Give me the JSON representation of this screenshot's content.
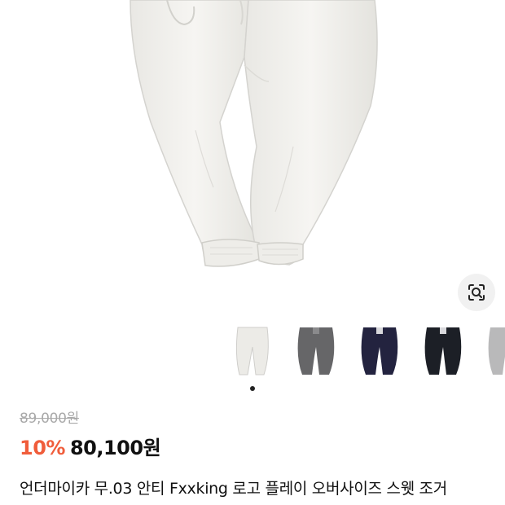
{
  "product": {
    "original_price": "89,000원",
    "discount_rate": "10%",
    "sale_price": "80,100원",
    "title": "언더마이카 무.03 안티 Fxxking 로고 플레이 오버사이즈 스웻 조거"
  },
  "gallery": {
    "current_index": 1,
    "total_dots": 1,
    "thumbnails": [
      {
        "name": "thumbnail-white",
        "color": "#ecebe7"
      },
      {
        "name": "thumbnail-gray",
        "color": "#666668"
      },
      {
        "name": "thumbnail-navy",
        "color": "#23233f"
      },
      {
        "name": "thumbnail-black",
        "color": "#1c1f26"
      },
      {
        "name": "thumbnail-light-gray",
        "color": "#b9b9ba"
      }
    ]
  },
  "icons": {
    "lens": "lens-search-icon"
  },
  "colors": {
    "discount": "#f05d3b",
    "strikethrough": "#a9a9a9",
    "text": "#111111"
  }
}
